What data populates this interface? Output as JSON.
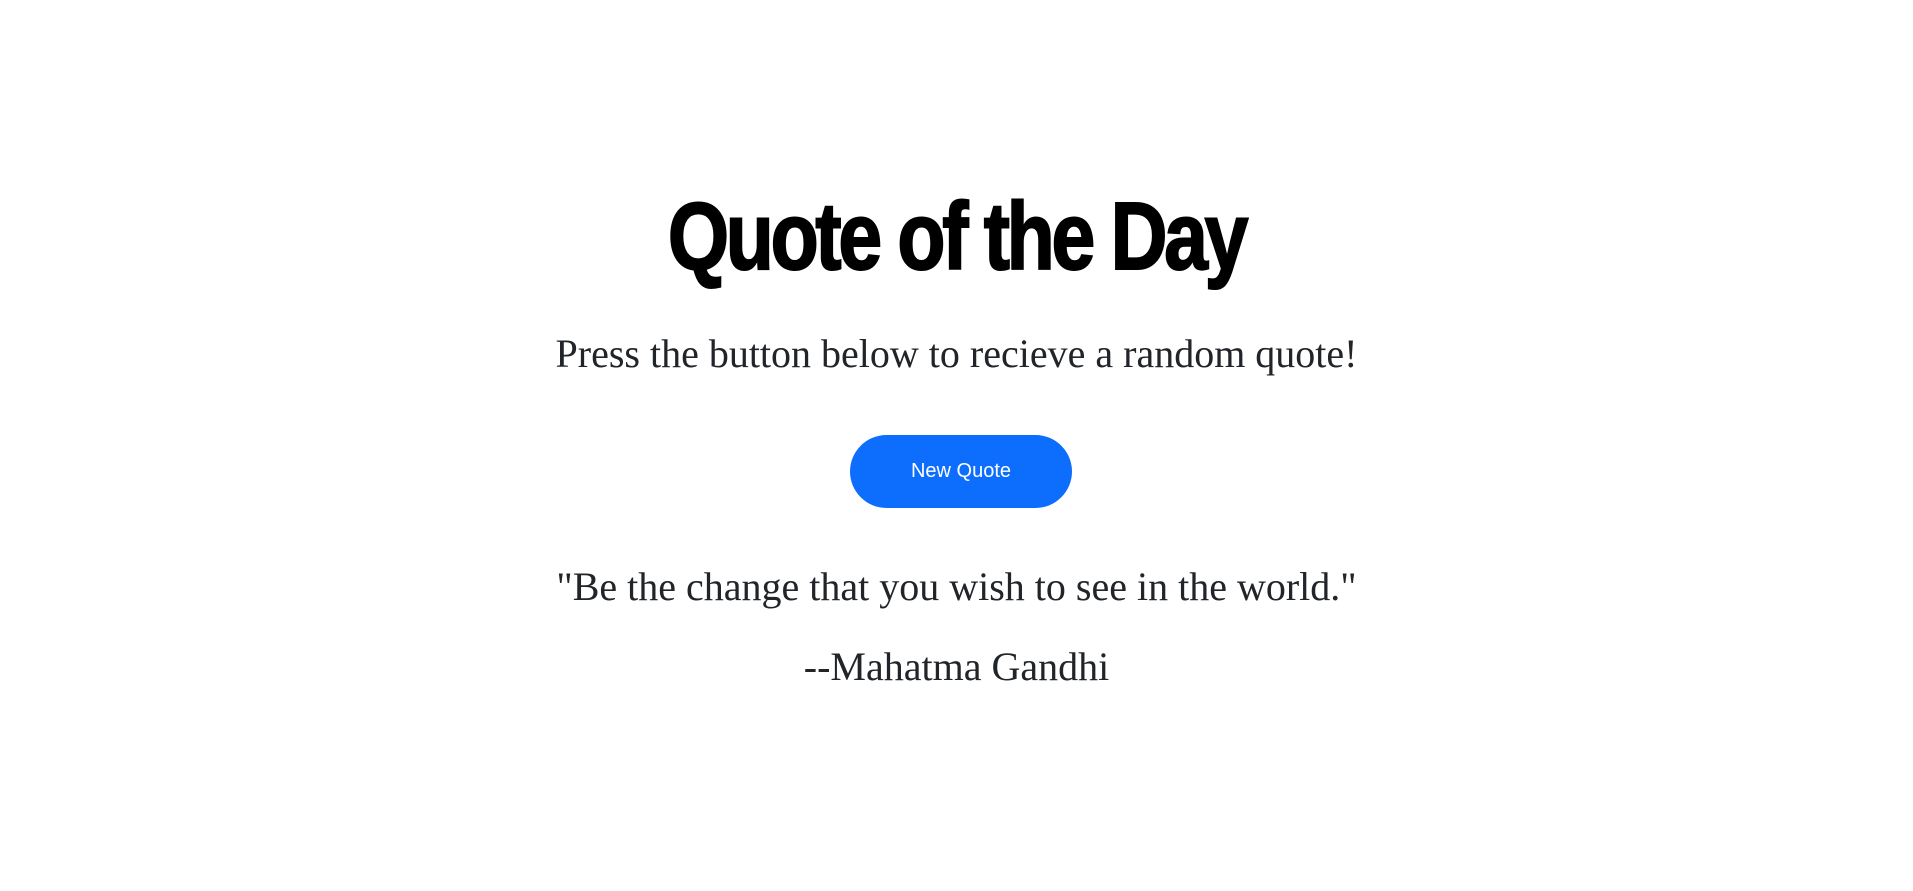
{
  "header": {
    "title": "Quote of the Day",
    "subtitle": "Press the button below to recieve a random quote!"
  },
  "actions": {
    "new_quote_label": "New Quote"
  },
  "quote": {
    "text": "\"Be the change that you wish to see in the world.\"",
    "author": "--Mahatma Gandhi"
  },
  "colors": {
    "button_background": "#0d6efd",
    "button_text": "#ffffff",
    "title_text": "#000000",
    "body_text": "#212529",
    "page_background": "#ffffff"
  }
}
